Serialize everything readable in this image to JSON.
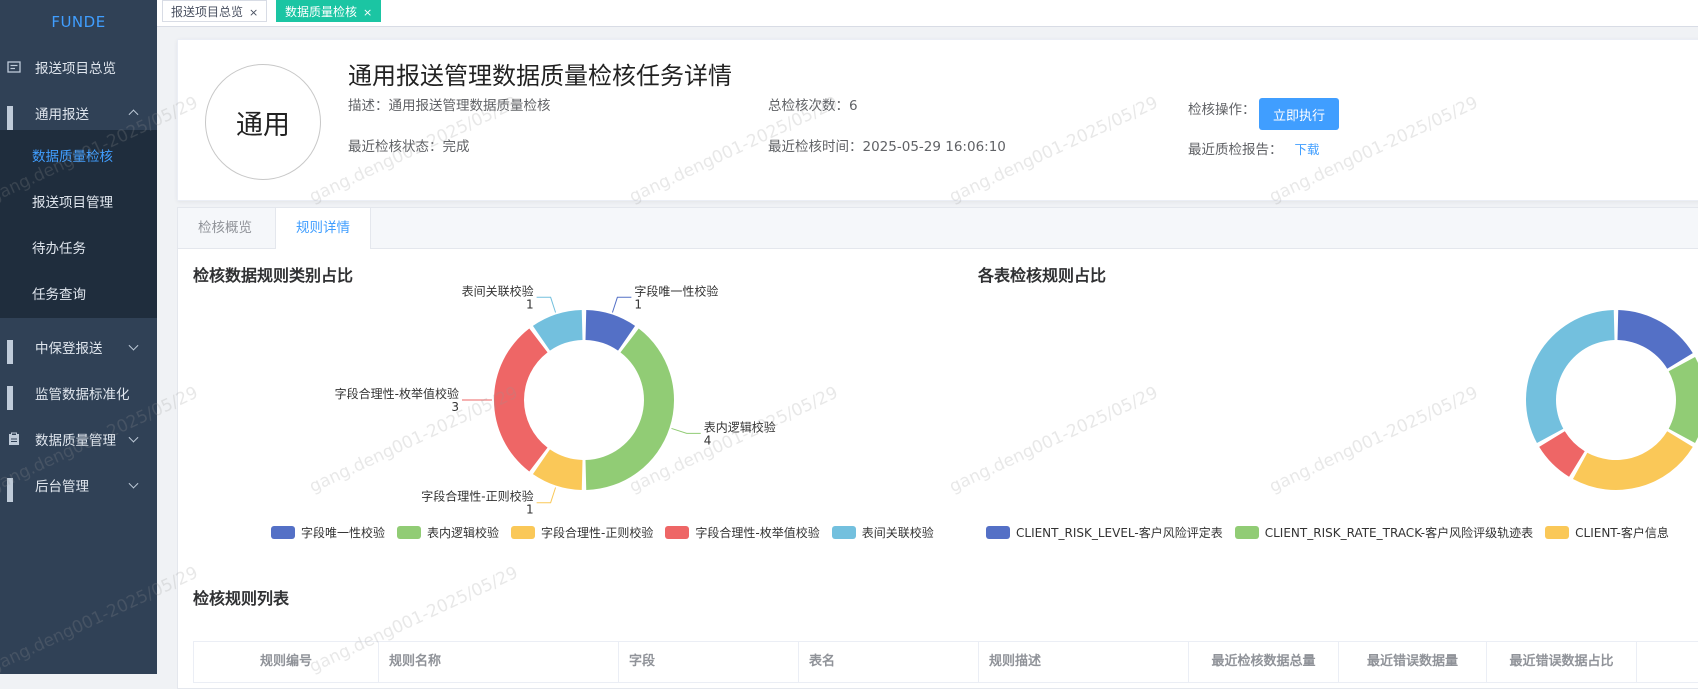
{
  "sidebar": {
    "logo": "FUNDE",
    "items": [
      {
        "label": "报送项目总览"
      },
      {
        "label": "通用报送"
      },
      {
        "label": "中保登报送"
      },
      {
        "label": "监管数据标准化"
      },
      {
        "label": "数据质量管理"
      },
      {
        "label": "后台管理"
      }
    ],
    "sub_items": [
      {
        "label": "数据质量检核",
        "active": true
      },
      {
        "label": "报送项目管理"
      },
      {
        "label": "待办任务"
      },
      {
        "label": "任务查询"
      }
    ]
  },
  "tabs": [
    {
      "label": "报送项目总览",
      "close": "×"
    },
    {
      "label": "数据质量检核",
      "close": "×",
      "active": true
    }
  ],
  "header": {
    "avatar_text": "通用",
    "title": "通用报送管理数据质量检核任务详情",
    "desc_label": "描述：",
    "desc_value": "通用报送管理数据质量检核",
    "status_label": "最近检核状态：",
    "status_value": "完成",
    "total_label": "总检核次数：",
    "total_value": "6",
    "time_label": "最近检核时间：",
    "time_value": "2025-05-29 16:06:10",
    "op_label": "检核操作：",
    "run_button": "立即执行",
    "report_label": "最近质检报告：",
    "report_link": "下载"
  },
  "panel_tabs": [
    "检核概览",
    "规则详情"
  ],
  "section1_title": "检核数据规则类别占比",
  "section2_title": "各表检核规则占比",
  "list_title": "检核规则列表",
  "chart_data": [
    {
      "type": "pie",
      "title": "检核数据规则类别占比",
      "categories": [
        "字段唯一性校验",
        "表内逻辑校验",
        "字段合理性-正则校验",
        "字段合理性-枚举值校验",
        "表间关联校验"
      ],
      "values": [
        1,
        4,
        1,
        3,
        1
      ],
      "colors": [
        "#5470c6",
        "#91cc75",
        "#fac858",
        "#ee6666",
        "#73c0de"
      ],
      "legend": "bottom"
    },
    {
      "type": "pie",
      "title": "各表检核规则占比",
      "categories": [
        "CLIENT_RISK_LEVEL-客户风险评定表",
        "CLIENT_RISK_RATE_TRACK-客户风险评级轨迹表",
        "CLIENT-客户信息"
      ],
      "values": [
        2,
        2,
        3,
        1,
        4
      ],
      "colors": [
        "#5470c6",
        "#91cc75",
        "#fac858",
        "#ee6666",
        "#73c0de"
      ],
      "legend": "bottom"
    }
  ],
  "legend2": [
    "CLIENT_RISK_LEVEL-客户风险评定表",
    "CLIENT_RISK_RATE_TRACK-客户风险评级轨迹表",
    "CLIENT-客户信息"
  ],
  "table": {
    "columns": [
      "规则编号",
      "规则名称",
      "字段",
      "表名",
      "规则描述",
      "最近检核数据总量",
      "最近错误数据量",
      "最近错误数据占比"
    ]
  },
  "watermark": "gang.deng001-2025/05/29"
}
